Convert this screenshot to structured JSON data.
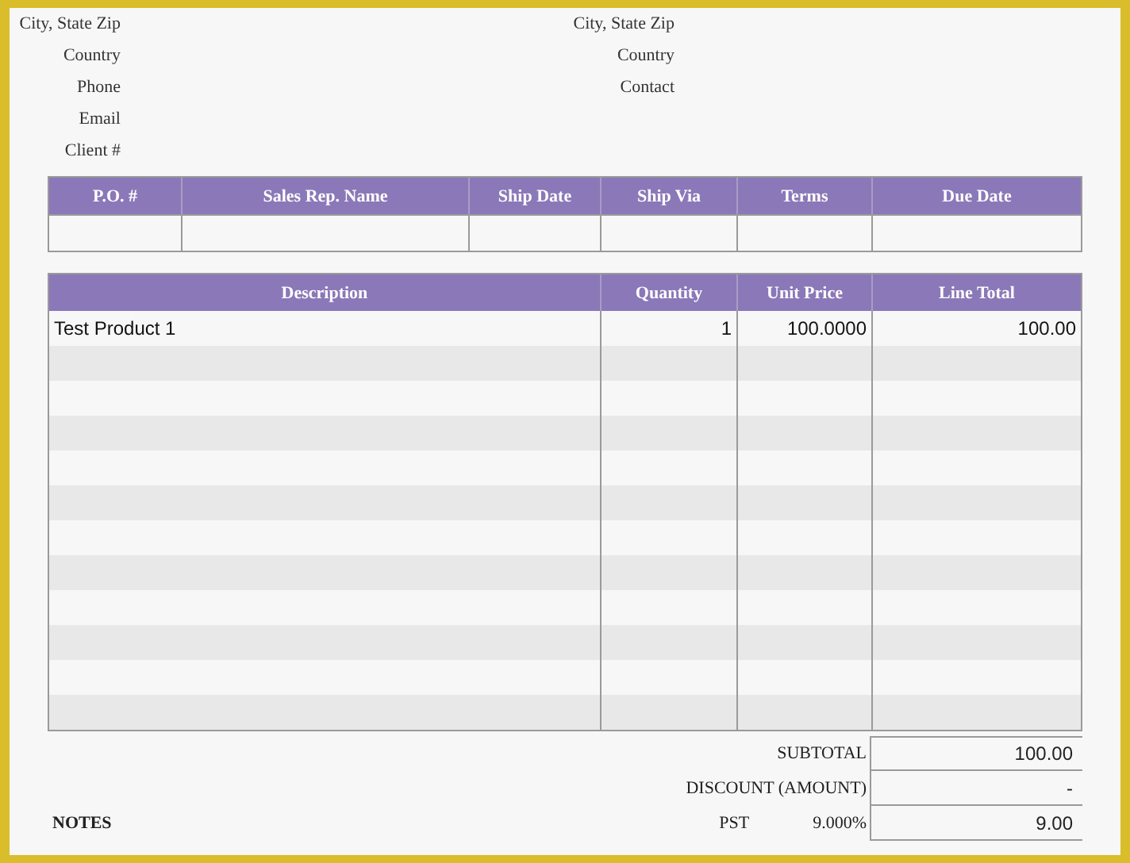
{
  "address_rows": [
    {
      "left": "City, State Zip",
      "right": "City, State Zip"
    },
    {
      "left": "Country",
      "right": "Country"
    },
    {
      "left": "Phone",
      "right": "Contact"
    },
    {
      "left": "Email"
    },
    {
      "left": "Client #"
    }
  ],
  "order_table": {
    "columns": [
      "P.O. #",
      "Sales Rep. Name",
      "Ship Date",
      "Ship Via",
      "Terms",
      "Due Date"
    ]
  },
  "items_table": {
    "columns": [
      "Description",
      "Quantity",
      "Unit Price",
      "Line Total"
    ],
    "rows": [
      {
        "description": "Test Product 1",
        "quantity": "1",
        "unit_price": "100.0000",
        "line_total": "100.00"
      }
    ]
  },
  "totals": [
    {
      "kind": "total",
      "label": "SUBTOTAL",
      "value": "100.00"
    },
    {
      "kind": "total",
      "label": "DISCOUNT (AMOUNT)",
      "value": "-"
    },
    {
      "kind": "tax",
      "label": "PST",
      "rate": "9.000%",
      "value": "9.00"
    }
  ],
  "notes_heading": "NOTES"
}
